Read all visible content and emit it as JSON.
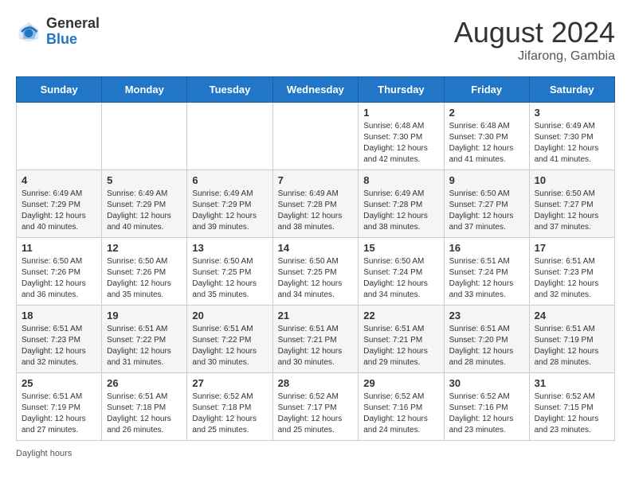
{
  "header": {
    "logo_line1": "General",
    "logo_line2": "Blue",
    "month_year": "August 2024",
    "location": "Jifarong, Gambia"
  },
  "weekdays": [
    "Sunday",
    "Monday",
    "Tuesday",
    "Wednesday",
    "Thursday",
    "Friday",
    "Saturday"
  ],
  "weeks": [
    [
      {
        "day": "",
        "sunrise": "",
        "sunset": "",
        "daylight": ""
      },
      {
        "day": "",
        "sunrise": "",
        "sunset": "",
        "daylight": ""
      },
      {
        "day": "",
        "sunrise": "",
        "sunset": "",
        "daylight": ""
      },
      {
        "day": "",
        "sunrise": "",
        "sunset": "",
        "daylight": ""
      },
      {
        "day": "1",
        "sunrise": "Sunrise: 6:48 AM",
        "sunset": "Sunset: 7:30 PM",
        "daylight": "Daylight: 12 hours and 42 minutes."
      },
      {
        "day": "2",
        "sunrise": "Sunrise: 6:48 AM",
        "sunset": "Sunset: 7:30 PM",
        "daylight": "Daylight: 12 hours and 41 minutes."
      },
      {
        "day": "3",
        "sunrise": "Sunrise: 6:49 AM",
        "sunset": "Sunset: 7:30 PM",
        "daylight": "Daylight: 12 hours and 41 minutes."
      }
    ],
    [
      {
        "day": "4",
        "sunrise": "Sunrise: 6:49 AM",
        "sunset": "Sunset: 7:29 PM",
        "daylight": "Daylight: 12 hours and 40 minutes."
      },
      {
        "day": "5",
        "sunrise": "Sunrise: 6:49 AM",
        "sunset": "Sunset: 7:29 PM",
        "daylight": "Daylight: 12 hours and 40 minutes."
      },
      {
        "day": "6",
        "sunrise": "Sunrise: 6:49 AM",
        "sunset": "Sunset: 7:29 PM",
        "daylight": "Daylight: 12 hours and 39 minutes."
      },
      {
        "day": "7",
        "sunrise": "Sunrise: 6:49 AM",
        "sunset": "Sunset: 7:28 PM",
        "daylight": "Daylight: 12 hours and 38 minutes."
      },
      {
        "day": "8",
        "sunrise": "Sunrise: 6:49 AM",
        "sunset": "Sunset: 7:28 PM",
        "daylight": "Daylight: 12 hours and 38 minutes."
      },
      {
        "day": "9",
        "sunrise": "Sunrise: 6:50 AM",
        "sunset": "Sunset: 7:27 PM",
        "daylight": "Daylight: 12 hours and 37 minutes."
      },
      {
        "day": "10",
        "sunrise": "Sunrise: 6:50 AM",
        "sunset": "Sunset: 7:27 PM",
        "daylight": "Daylight: 12 hours and 37 minutes."
      }
    ],
    [
      {
        "day": "11",
        "sunrise": "Sunrise: 6:50 AM",
        "sunset": "Sunset: 7:26 PM",
        "daylight": "Daylight: 12 hours and 36 minutes."
      },
      {
        "day": "12",
        "sunrise": "Sunrise: 6:50 AM",
        "sunset": "Sunset: 7:26 PM",
        "daylight": "Daylight: 12 hours and 35 minutes."
      },
      {
        "day": "13",
        "sunrise": "Sunrise: 6:50 AM",
        "sunset": "Sunset: 7:25 PM",
        "daylight": "Daylight: 12 hours and 35 minutes."
      },
      {
        "day": "14",
        "sunrise": "Sunrise: 6:50 AM",
        "sunset": "Sunset: 7:25 PM",
        "daylight": "Daylight: 12 hours and 34 minutes."
      },
      {
        "day": "15",
        "sunrise": "Sunrise: 6:50 AM",
        "sunset": "Sunset: 7:24 PM",
        "daylight": "Daylight: 12 hours and 34 minutes."
      },
      {
        "day": "16",
        "sunrise": "Sunrise: 6:51 AM",
        "sunset": "Sunset: 7:24 PM",
        "daylight": "Daylight: 12 hours and 33 minutes."
      },
      {
        "day": "17",
        "sunrise": "Sunrise: 6:51 AM",
        "sunset": "Sunset: 7:23 PM",
        "daylight": "Daylight: 12 hours and 32 minutes."
      }
    ],
    [
      {
        "day": "18",
        "sunrise": "Sunrise: 6:51 AM",
        "sunset": "Sunset: 7:23 PM",
        "daylight": "Daylight: 12 hours and 32 minutes."
      },
      {
        "day": "19",
        "sunrise": "Sunrise: 6:51 AM",
        "sunset": "Sunset: 7:22 PM",
        "daylight": "Daylight: 12 hours and 31 minutes."
      },
      {
        "day": "20",
        "sunrise": "Sunrise: 6:51 AM",
        "sunset": "Sunset: 7:22 PM",
        "daylight": "Daylight: 12 hours and 30 minutes."
      },
      {
        "day": "21",
        "sunrise": "Sunrise: 6:51 AM",
        "sunset": "Sunset: 7:21 PM",
        "daylight": "Daylight: 12 hours and 30 minutes."
      },
      {
        "day": "22",
        "sunrise": "Sunrise: 6:51 AM",
        "sunset": "Sunset: 7:21 PM",
        "daylight": "Daylight: 12 hours and 29 minutes."
      },
      {
        "day": "23",
        "sunrise": "Sunrise: 6:51 AM",
        "sunset": "Sunset: 7:20 PM",
        "daylight": "Daylight: 12 hours and 28 minutes."
      },
      {
        "day": "24",
        "sunrise": "Sunrise: 6:51 AM",
        "sunset": "Sunset: 7:19 PM",
        "daylight": "Daylight: 12 hours and 28 minutes."
      }
    ],
    [
      {
        "day": "25",
        "sunrise": "Sunrise: 6:51 AM",
        "sunset": "Sunset: 7:19 PM",
        "daylight": "Daylight: 12 hours and 27 minutes."
      },
      {
        "day": "26",
        "sunrise": "Sunrise: 6:51 AM",
        "sunset": "Sunset: 7:18 PM",
        "daylight": "Daylight: 12 hours and 26 minutes."
      },
      {
        "day": "27",
        "sunrise": "Sunrise: 6:52 AM",
        "sunset": "Sunset: 7:18 PM",
        "daylight": "Daylight: 12 hours and 25 minutes."
      },
      {
        "day": "28",
        "sunrise": "Sunrise: 6:52 AM",
        "sunset": "Sunset: 7:17 PM",
        "daylight": "Daylight: 12 hours and 25 minutes."
      },
      {
        "day": "29",
        "sunrise": "Sunrise: 6:52 AM",
        "sunset": "Sunset: 7:16 PM",
        "daylight": "Daylight: 12 hours and 24 minutes."
      },
      {
        "day": "30",
        "sunrise": "Sunrise: 6:52 AM",
        "sunset": "Sunset: 7:16 PM",
        "daylight": "Daylight: 12 hours and 23 minutes."
      },
      {
        "day": "31",
        "sunrise": "Sunrise: 6:52 AM",
        "sunset": "Sunset: 7:15 PM",
        "daylight": "Daylight: 12 hours and 23 minutes."
      }
    ]
  ],
  "footer": {
    "note": "Daylight hours"
  }
}
